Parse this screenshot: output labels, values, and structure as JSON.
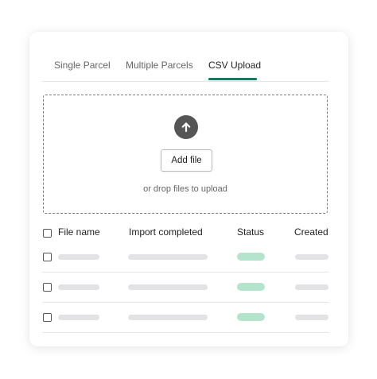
{
  "tabs": [
    {
      "label": "Single Parcel",
      "active": false
    },
    {
      "label": "Multiple Parcels",
      "active": false
    },
    {
      "label": "CSV Upload",
      "active": true
    }
  ],
  "dropzone": {
    "icon": "upload-arrow-icon",
    "button_label": "Add file",
    "helper_text": "or drop files to upload"
  },
  "table": {
    "headers": [
      "File name",
      "Import completed",
      "Status",
      "Created"
    ],
    "rows": [
      {
        "placeholder": true
      },
      {
        "placeholder": true
      },
      {
        "placeholder": true
      }
    ]
  },
  "colors": {
    "accent": "#1c7a63",
    "status_pill": "#b5e4cd",
    "placeholder_bar": "#e3e3e6",
    "icon": "#555555"
  }
}
